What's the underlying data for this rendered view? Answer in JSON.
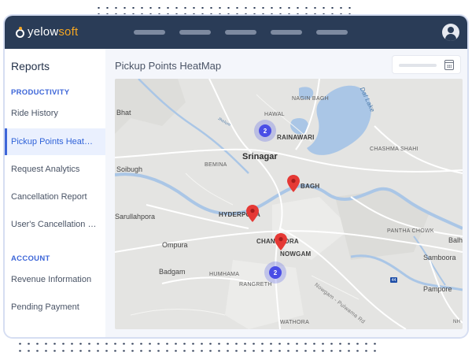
{
  "brand": {
    "name_prefix": "yelow",
    "name_suffix": "soft"
  },
  "sidebar": {
    "title": "Reports",
    "sections": [
      {
        "label": "PRODUCTIVITY"
      },
      {
        "label": "ACCOUNT"
      }
    ],
    "items": [
      {
        "label": "Ride History"
      },
      {
        "label": "Pickup Points HeatMap",
        "active": true
      },
      {
        "label": "Request Analytics"
      },
      {
        "label": "Cancellation Report"
      },
      {
        "label": "User's Cancellation Report"
      },
      {
        "label": "Revenue Information"
      },
      {
        "label": "Pending Payment"
      }
    ]
  },
  "main": {
    "title": "Pickup Points HeatMap"
  },
  "map": {
    "city": "Srinagar",
    "labels": {
      "bhat": "Bhat",
      "hawal": "HAWAL",
      "nagin_bagh": "NAGIN BAGH",
      "dal_lake": "Dal Lake",
      "rainawari": "RAINAWARI",
      "chashma_shahi": "CHASHMA SHAHI",
      "soibugh": "Soibugh",
      "bemina": "BEMINA",
      "bagh": "BAGH",
      "sarullahpora": "Sarullahpora",
      "hyderpora": "HYDERPORA",
      "pantha_chowk": "PANTHA CHOWK",
      "balh": "Balh",
      "ompura": "Ompura",
      "chanapora": "CHANAPORA",
      "nowgam": "NOWGAM",
      "samboora": "Samboora",
      "badgam": "Badgam",
      "humhama": "HUMHAMA",
      "rangreth": "RANGRETH",
      "pampore": "Pampore",
      "wathora": "WATHORA",
      "road": "Nowgam - Pulwama Rd",
      "jhelum": "Jhelum",
      "highway": "44",
      "nh": "NH"
    },
    "clusters": [
      {
        "count": "2"
      },
      {
        "count": "2"
      }
    ],
    "colors": {
      "marker": "#e53935",
      "cluster": "#4a4ee6",
      "water": "#aac6e6"
    }
  }
}
